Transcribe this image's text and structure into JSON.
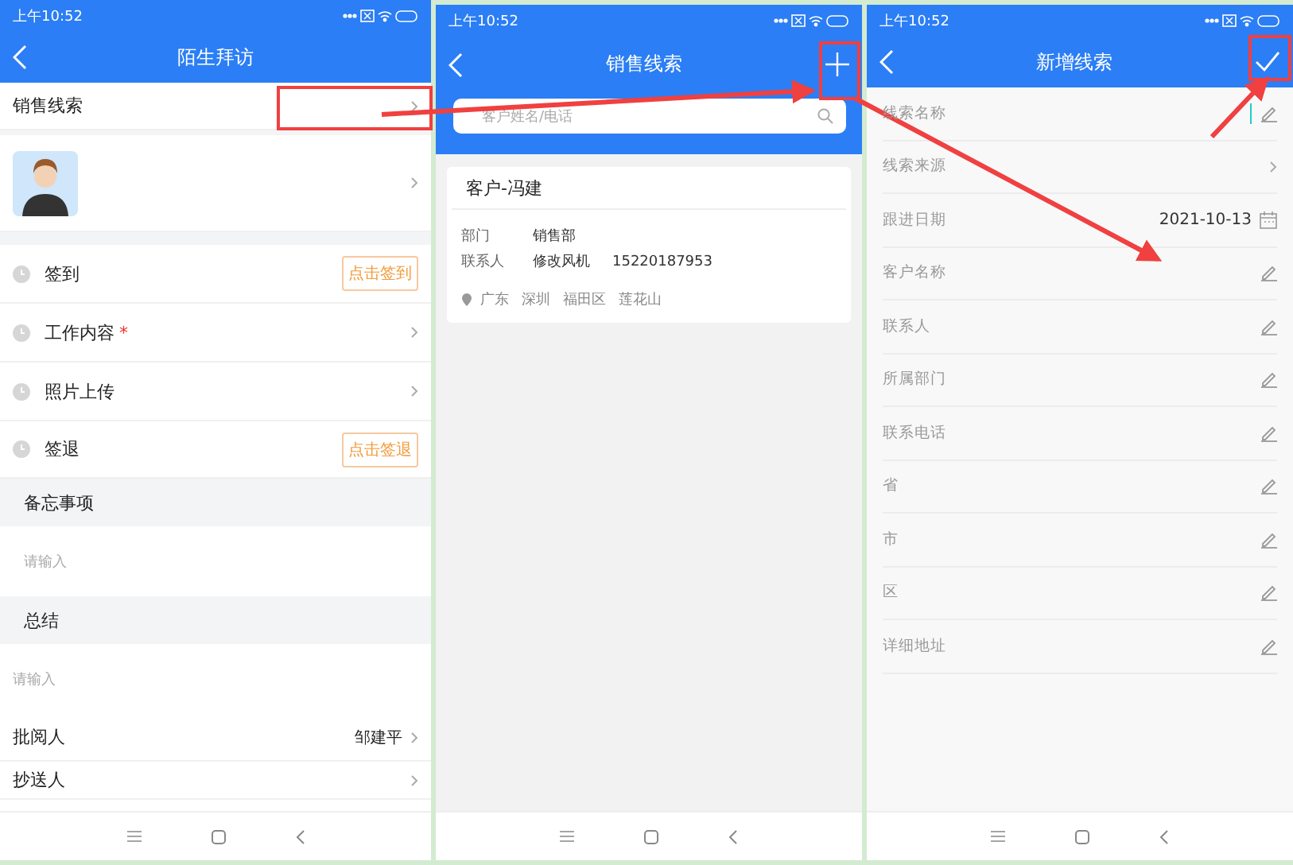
{
  "visit_screen": {
    "status_time": "上午10:52",
    "title": "陌生拜访",
    "lead_row": {
      "label": "销售线索"
    },
    "checkins": [
      {
        "kind": "button",
        "label": "签到",
        "action": "点击签到"
      },
      {
        "kind": "link",
        "label": "工作内容",
        "marker": "*"
      },
      {
        "kind": "link",
        "label": "照片上传"
      },
      {
        "kind": "button",
        "label": "签退",
        "action": "点击签退"
      }
    ],
    "memo": {
      "title": "备忘事项",
      "placeholder": "请输入"
    },
    "summary": {
      "title": "总结",
      "placeholder": "请输入"
    },
    "people": [
      {
        "label": "批阅人",
        "value": "邹建平"
      },
      {
        "label": "抄送人"
      }
    ]
  },
  "leads_screen": {
    "status_time": "上午10:52",
    "title": "销售线索",
    "search": {
      "placeholder": "客户姓名/电话"
    },
    "cards": [
      {
        "title": "客户-冯建",
        "fields": [
          {
            "label": "部门",
            "values": [
              "销售部"
            ]
          },
          {
            "label": "联系人",
            "values": [
              "修改风机",
              "15220187953"
            ]
          }
        ],
        "address": [
          "广东",
          "深圳",
          "福田区",
          "莲花山"
        ]
      }
    ]
  },
  "new_lead_screen": {
    "status_time": "上午10:52",
    "title": "新增线索",
    "fields": [
      {
        "kind": "edit",
        "label": "线索名称",
        "focused": true
      },
      {
        "kind": "select",
        "label": "线索来源"
      },
      {
        "kind": "date",
        "label": "跟进日期",
        "value": "2021-10-13"
      },
      {
        "kind": "edit",
        "label": "客户名称",
        "focused": false
      },
      {
        "kind": "edit",
        "label": "联系人",
        "focused": false
      },
      {
        "kind": "edit",
        "label": "所属部门",
        "focused": false
      },
      {
        "kind": "edit",
        "label": "联系电话",
        "focused": false
      },
      {
        "kind": "edit",
        "label": "省",
        "focused": false
      },
      {
        "kind": "edit",
        "label": "市",
        "focused": false
      },
      {
        "kind": "edit",
        "label": "区",
        "focused": false
      },
      {
        "kind": "edit",
        "label": "详细地址",
        "focused": false
      }
    ]
  }
}
